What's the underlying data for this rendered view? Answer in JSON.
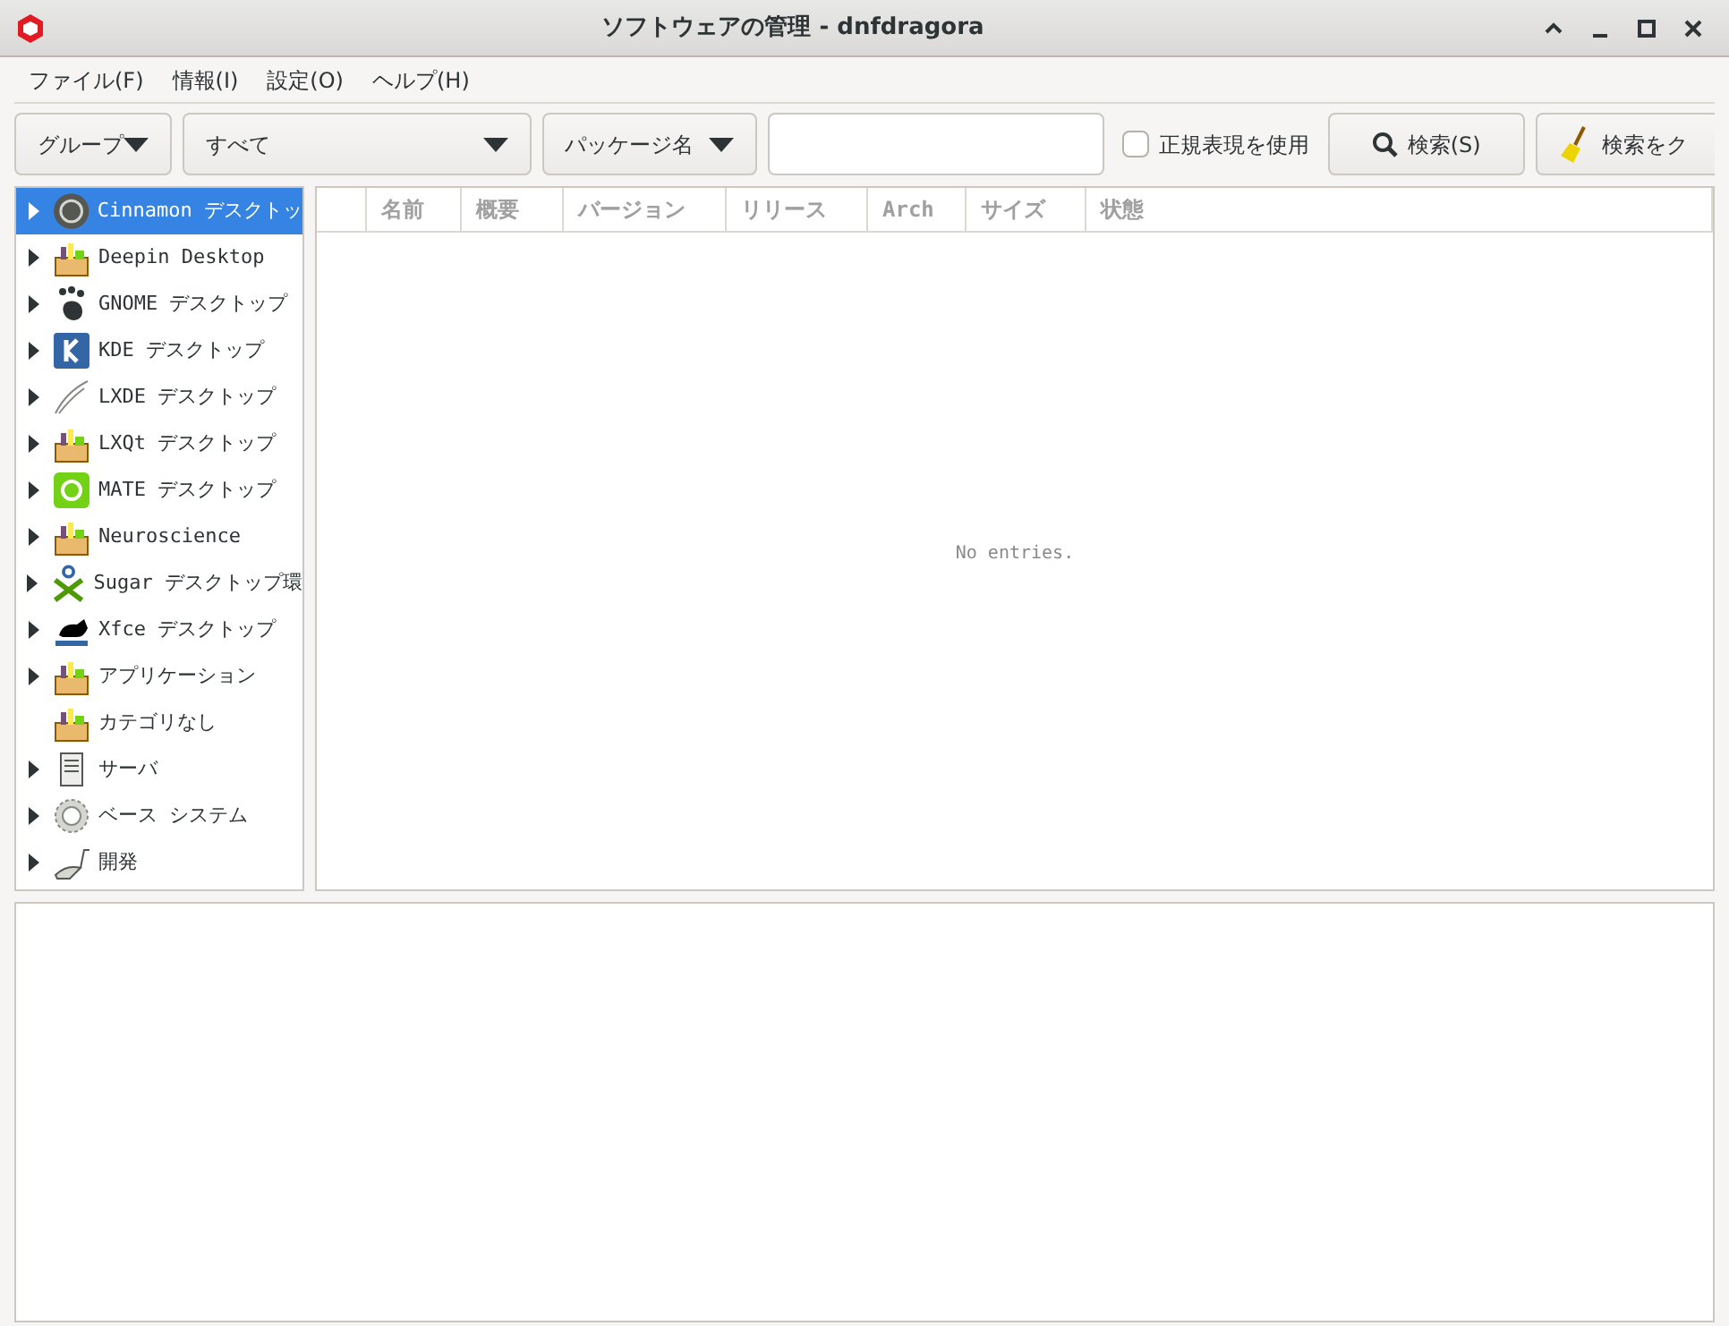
{
  "window": {
    "title": "ソフトウェアの管理 - dnfdragora"
  },
  "menu": [
    "ファイル(F)",
    "情報(I)",
    "設定(O)",
    "ヘルプ(H)"
  ],
  "toolbar": {
    "group_dropdown": "グループ",
    "filter_dropdown": "すべて",
    "field_dropdown": "パッケージ名",
    "regex": {
      "label": "正規表現を使用",
      "checked": false
    },
    "search_button": "検索(S)",
    "clear_button": "検索をク"
  },
  "tree": [
    {
      "label": "Cinnamon デスクトッ",
      "kind": "cinnamon",
      "expandable": true,
      "selected": true
    },
    {
      "label": "Deepin Desktop",
      "kind": "package",
      "expandable": true,
      "selected": false
    },
    {
      "label": "GNOME デスクトップ",
      "kind": "gnome",
      "expandable": true,
      "selected": false
    },
    {
      "label": "KDE デスクトップ",
      "kind": "kde",
      "expandable": true,
      "selected": false
    },
    {
      "label": "LXDE デスクトップ",
      "kind": "lxde",
      "expandable": true,
      "selected": false
    },
    {
      "label": "LXQt デスクトップ",
      "kind": "package",
      "expandable": true,
      "selected": false
    },
    {
      "label": "MATE デスクトップ",
      "kind": "mate",
      "expandable": true,
      "selected": false
    },
    {
      "label": "Neuroscience",
      "kind": "package",
      "expandable": true,
      "selected": false
    },
    {
      "label": "Sugar デスクトップ環",
      "kind": "sugar",
      "expandable": true,
      "selected": false
    },
    {
      "label": "Xfce デスクトップ",
      "kind": "xfce",
      "expandable": true,
      "selected": false
    },
    {
      "label": "アプリケーション",
      "kind": "package",
      "expandable": true,
      "selected": false
    },
    {
      "label": "カテゴリなし",
      "kind": "package",
      "expandable": false,
      "selected": false
    },
    {
      "label": "サーバ",
      "kind": "server",
      "expandable": true,
      "selected": false
    },
    {
      "label": "ベース システム",
      "kind": "gear",
      "expandable": true,
      "selected": false
    },
    {
      "label": "開発",
      "kind": "devel",
      "expandable": true,
      "selected": false
    }
  ],
  "table": {
    "columns": [
      "名前",
      "概要",
      "バージョン",
      "リリース",
      "Arch",
      "サイズ",
      "状態"
    ],
    "empty_message": "No entries."
  }
}
